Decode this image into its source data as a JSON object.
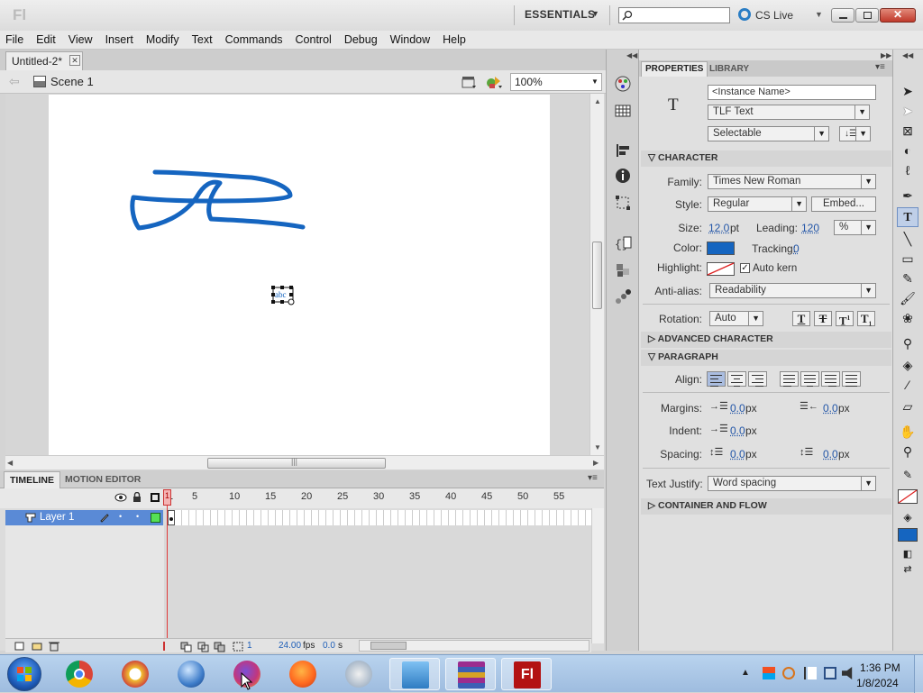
{
  "app": {
    "logo": "Fl",
    "workspace": "ESSENTIALS",
    "cs_live": "CS Live"
  },
  "menu": [
    "File",
    "Edit",
    "View",
    "Insert",
    "Modify",
    "Text",
    "Commands",
    "Control",
    "Debug",
    "Window",
    "Help"
  ],
  "document": {
    "tab": "Untitled-2*",
    "close": "✕",
    "scene": "Scene 1",
    "zoom": "100%"
  },
  "timeline": {
    "tabs": [
      "TIMELINE",
      "MOTION EDITOR"
    ],
    "frame_numbers": [
      "1",
      "5",
      "10",
      "15",
      "20",
      "25",
      "30",
      "35",
      "40",
      "45",
      "50",
      "55"
    ],
    "layer": "Layer 1",
    "current_frame": "1",
    "fps": "24.00",
    "fps_unit": "fps",
    "elapsed": "0.0",
    "elapsed_unit": "s"
  },
  "properties": {
    "tabs": [
      "PROPERTIES",
      "LIBRARY"
    ],
    "instance_name_placeholder": "<Instance Name>",
    "text_engine": "TLF Text",
    "behavior": "Selectable",
    "character_header": "CHARACTER",
    "family_label": "Family:",
    "family": "Times New Roman",
    "style_label": "Style:",
    "style": "Regular",
    "embed": "Embed...",
    "size_label": "Size:",
    "size": "12.0",
    "size_unit": "pt",
    "leading_label": "Leading:",
    "leading": "120",
    "leading_unit": "%",
    "color_label": "Color:",
    "color": "#1565c0",
    "tracking_label": "Tracking:",
    "tracking": "0",
    "highlight_label": "Highlight:",
    "autokern_label": "Auto kern",
    "autokern_checked": true,
    "antialias_label": "Anti-alias:",
    "antialias": "Readability",
    "rotation_label": "Rotation:",
    "rotation": "Auto",
    "advanced_header": "ADVANCED CHARACTER",
    "paragraph_header": "PARAGRAPH",
    "align_label": "Align:",
    "margins_label": "Margins:",
    "margin_left": "0.0",
    "margin_right": "0.0",
    "px": "px",
    "indent_label": "Indent:",
    "indent": "0.0",
    "spacing_label": "Spacing:",
    "spacing_before": "0.0",
    "spacing_after": "0.0",
    "justify_label": "Text Justify:",
    "justify": "Word spacing",
    "container_header": "CONTAINER AND FLOW"
  },
  "stage": {
    "text_box": "abc",
    "stroke_color": "#1565c0"
  },
  "taskbar": {
    "time": "1:36 PM",
    "date": "1/8/2024"
  }
}
